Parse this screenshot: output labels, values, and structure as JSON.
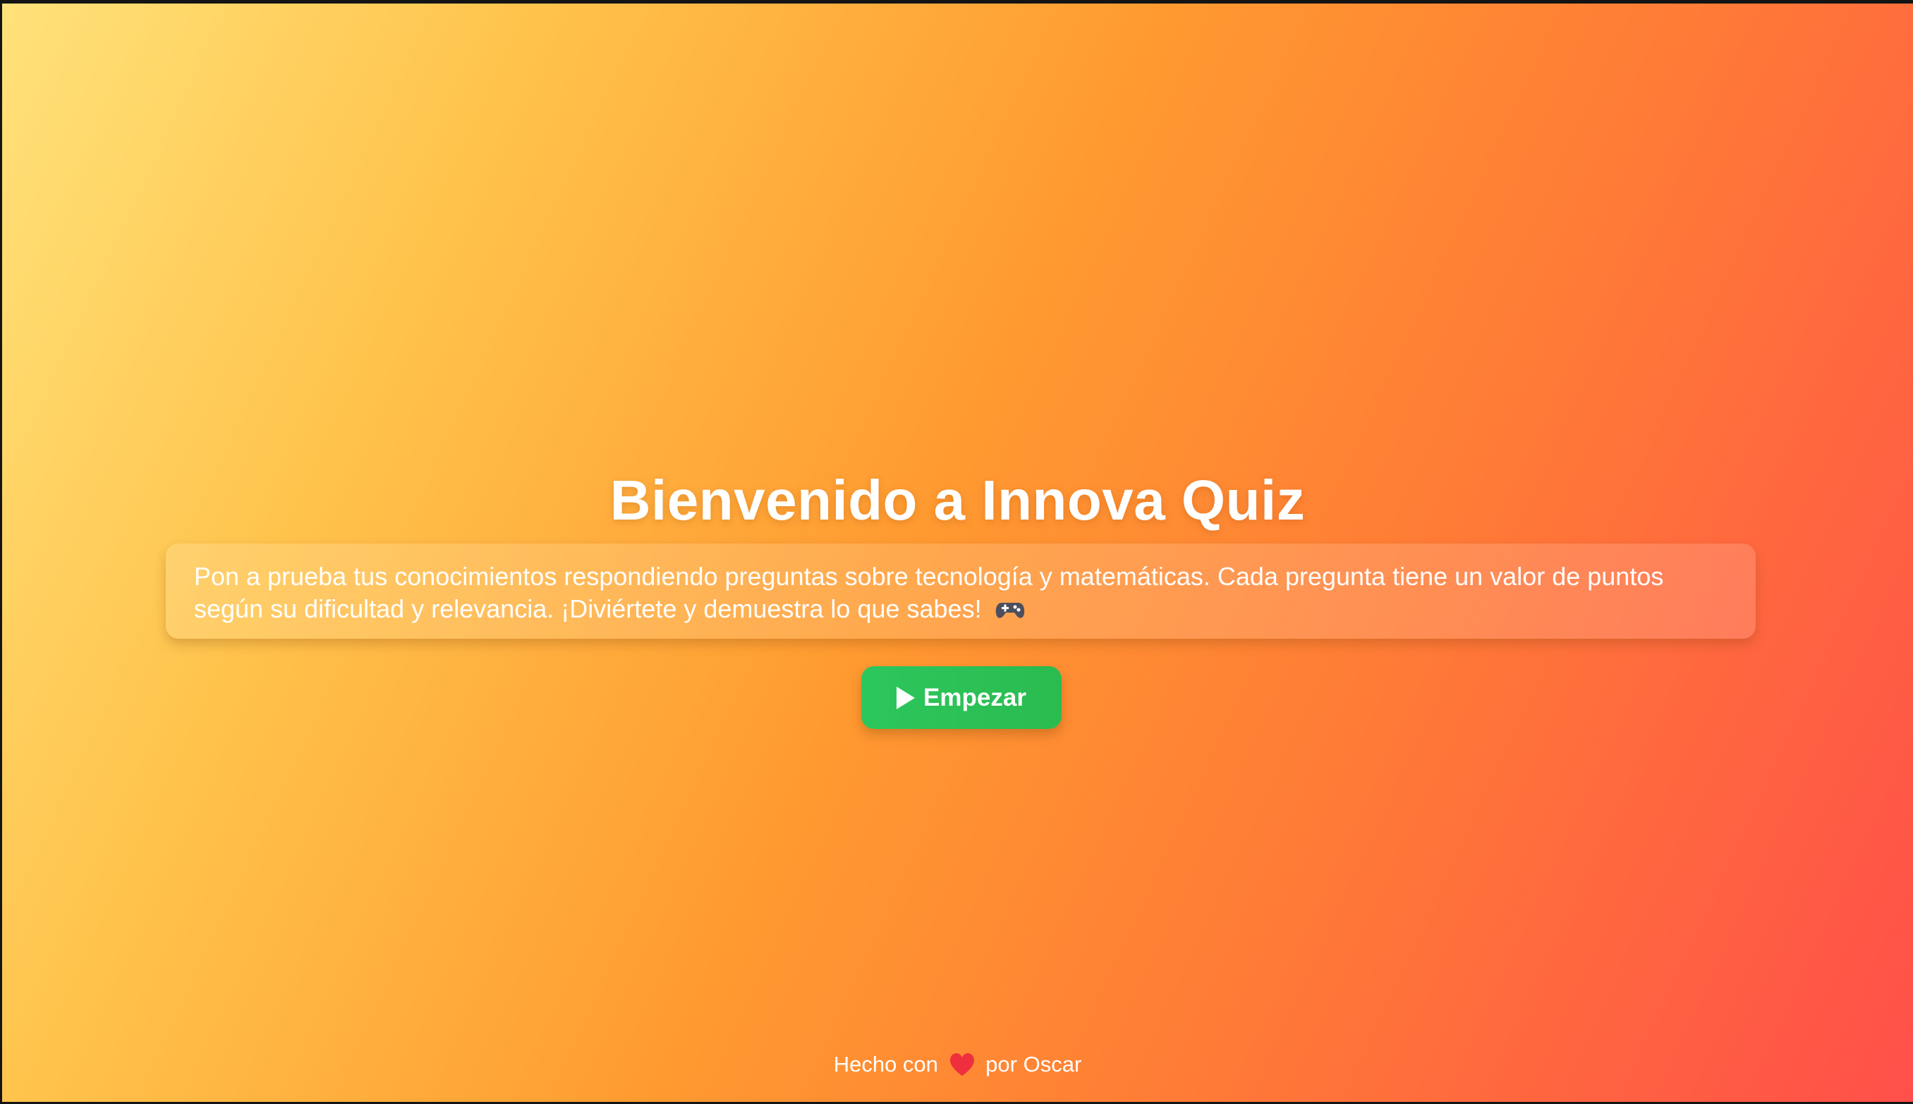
{
  "main": {
    "title": "Bienvenido a Innova Quiz",
    "description": "Pon a prueba tus conocimientos respondiendo preguntas sobre tecnología y matemáticas. Cada pregunta tiene un valor de puntos según su dificultad y relevancia. ¡Diviértete y demuestra lo que sabes!",
    "description_icon": "gamepad-icon",
    "start_button": {
      "label": "Empezar",
      "icon": "play-icon",
      "color": "#2bc258"
    }
  },
  "footer": {
    "prefix": "Hecho con",
    "icon": "heart-icon",
    "suffix": "por Oscar"
  },
  "colors": {
    "background_start": "#ffe27a",
    "background_end": "#ff4f4a",
    "accent_green": "#2bc258",
    "text": "#ffffff"
  }
}
